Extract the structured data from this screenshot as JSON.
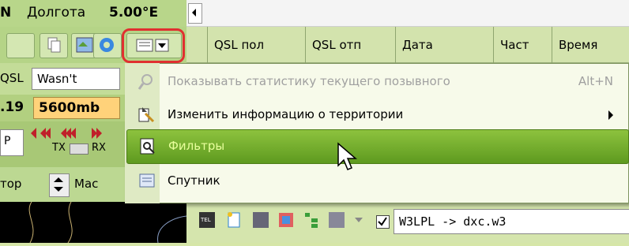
{
  "left": {
    "longitude_label": "Долгота",
    "longitude_value": "5.00°E",
    "row1_prefix": "N",
    "qsl_label": "QSL",
    "qsl_value": "Wasn't",
    "freq_value": ".19",
    "pressure_value": "5600mb",
    "tx_label": "TX",
    "rx_label": "RX",
    "p_label": "P",
    "tor_label": "тор",
    "mac_label": "Мас"
  },
  "grid": {
    "columns": [
      "QSL пол",
      "QSL отп",
      "Дата",
      "Част",
      "Время"
    ]
  },
  "menu": {
    "items": [
      {
        "label": "Показывать статистику текущего позывного",
        "shortcut": "Alt+N",
        "state": "disabled",
        "icon": "magnifier-icon"
      },
      {
        "label": "Изменить информацию о территории",
        "shortcut": "",
        "state": "normal",
        "icon": "territory-edit-icon",
        "submenu": true
      },
      {
        "label": "Фильтры",
        "shortcut": "",
        "state": "highlighted",
        "icon": "filter-icon"
      },
      {
        "label": "Спутник",
        "shortcut": "",
        "state": "normal",
        "icon": "satellite-icon"
      }
    ]
  },
  "bottom": {
    "cluster_text": "W3LPL -> dxc.w3",
    "cluster_checked": true
  },
  "colors": {
    "highlight": "#6aa82a",
    "callout": "#e03030"
  }
}
